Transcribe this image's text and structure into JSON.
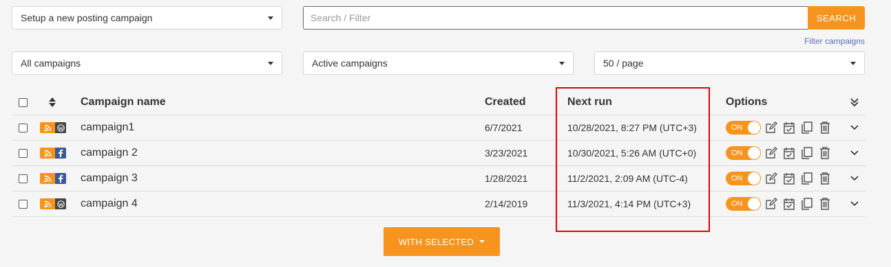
{
  "toolbar": {
    "setup_select": "Setup a new posting campaign",
    "search_placeholder": "Search / Filter",
    "search_button": "SEARCH",
    "filter_link": "Filter campaigns"
  },
  "filters": {
    "type": "All campaigns",
    "status": "Active campaigns",
    "per_page": "50 / page"
  },
  "table": {
    "headers": {
      "name": "Campaign name",
      "created": "Created",
      "next_run": "Next run",
      "options": "Options"
    },
    "rows": [
      {
        "name": "campaign1",
        "created": "6/7/2021",
        "next_run": "10/28/2021, 8:27 PM (UTC+3)",
        "destination": "wordpress",
        "toggle": "ON"
      },
      {
        "name": "campaign 2",
        "created": "3/23/2021",
        "next_run": "10/30/2021, 5:26 AM (UTC+0)",
        "destination": "facebook",
        "toggle": "ON"
      },
      {
        "name": "campaign 3",
        "created": "1/28/2021",
        "next_run": "11/2/2021, 2:09 AM (UTC-4)",
        "destination": "facebook",
        "toggle": "ON"
      },
      {
        "name": "campaign 4",
        "created": "2/14/2019",
        "next_run": "11/3/2021, 4:14 PM (UTC+3)",
        "destination": "wordpress",
        "toggle": "ON"
      }
    ]
  },
  "footer": {
    "with_selected": "WITH SELECTED"
  },
  "colors": {
    "accent": "#f7941d",
    "highlight": "#e00000",
    "link": "#5b6fb8"
  },
  "icons": [
    "rss-icon",
    "wordpress-icon",
    "facebook-icon",
    "edit-icon",
    "calendar-check-icon",
    "copy-icon",
    "trash-icon",
    "chevron-down-icon",
    "sort-icon",
    "expand-all-icon"
  ]
}
